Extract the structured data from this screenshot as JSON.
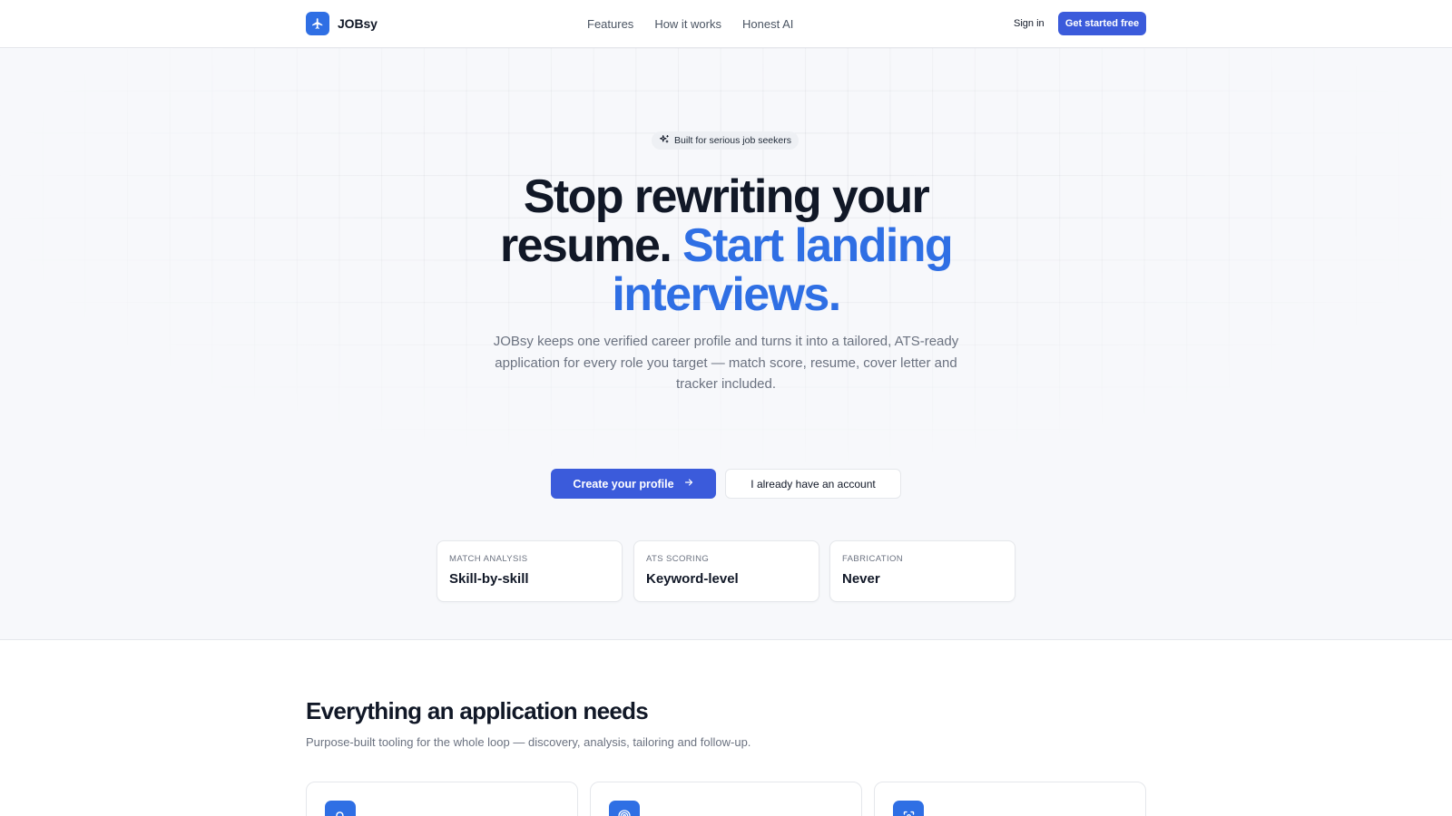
{
  "nav": {
    "brand": "JOBsy",
    "links": [
      "Features",
      "How it works",
      "Honest AI"
    ],
    "signin": "Sign in",
    "cta": "Get started free"
  },
  "hero": {
    "badge": "Built for serious job seekers",
    "headline_line1": "Stop rewriting your",
    "headline_line2_plain": "resume.",
    "headline_line2_accent": "Start landing",
    "headline_line3_accent": "interviews.",
    "subtitle": "JOBsy keeps one verified career profile and turns it into a tailored, ATS-ready application for every role you target — match score, resume, cover letter and tracker included.",
    "primary_cta": "Create your profile",
    "secondary_cta": "I already have an account",
    "stats": [
      {
        "label": "MATCH ANALYSIS",
        "value": "Skill-by-skill"
      },
      {
        "label": "ATS SCORING",
        "value": "Keyword-level"
      },
      {
        "label": "FABRICATION",
        "value": "Never"
      }
    ]
  },
  "features": {
    "title": "Everything an application needs",
    "subtitle": "Purpose-built tooling for the whole loop — discovery, analysis, tailoring and follow-up.",
    "cards": [
      {
        "icon": "search-icon"
      },
      {
        "icon": "target-icon"
      },
      {
        "icon": "scan-icon"
      }
    ]
  },
  "colors": {
    "brand": "#2f6fe4",
    "button": "#3b5bdb",
    "hero_bg": "#f7f8fb"
  }
}
